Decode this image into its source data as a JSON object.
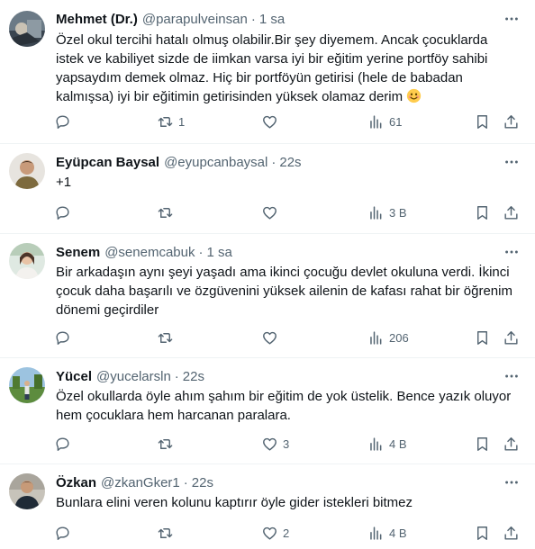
{
  "tweets": [
    {
      "name": "Mehmet (Dr.)",
      "handle": "@parapulveinsan",
      "time": "1 sa",
      "text": "Özel okul tercihi hatalı olmuş olabilir.Bir şey diyemem. Ancak çocuklarda istek ve kabiliyet sizde de iimkan varsa iyi bir eğitim yerine portföy sahibi yapsaydım demek olmaz. Hiç bir portföyün getirisi (hele de babadan kalmışsa) iyi bir eğitimin getirisinden yüksek olamaz derim",
      "emoji": "smiling-face-emoji",
      "replies": "",
      "retweets": "1",
      "likes": "",
      "views": "61"
    },
    {
      "name": "Eyüpcan Baysal",
      "handle": "@eyupcanbaysal",
      "time": "22s",
      "text": "+1",
      "replies": "",
      "retweets": "",
      "likes": "",
      "views": "3 B"
    },
    {
      "name": "Senem",
      "handle": "@senemcabuk",
      "time": "1 sa",
      "text": "Bir arkadaşın aynı şeyi yaşadı ama ikinci çocuğu devlet okuluna verdi. İkinci çocuk daha başarılı ve özgüvenini yüksek ailenin de kafası rahat bir öğrenim dönemi geçirdiler",
      "replies": "",
      "retweets": "",
      "likes": "",
      "views": "206"
    },
    {
      "name": "Yücel",
      "handle": "@yucelarsln",
      "time": "22s",
      "text": "Özel okullarda öyle ahım şahım bir eğitim de yok üstelik. Bence yazık oluyor hem çocuklara hem harcanan paralara.",
      "replies": "",
      "retweets": "",
      "likes": "3",
      "views": "4 B"
    },
    {
      "name": "Özkan",
      "handle": "@zkanGker1",
      "time": "22s",
      "text": "Bunlara elini veren kolunu kaptırır öyle gider istekleri bitmez",
      "replies": "",
      "retweets": "",
      "likes": "2",
      "views": "4 B"
    }
  ],
  "colors": {
    "text": "#0f1419",
    "secondary": "#536471",
    "divider": "#eff3f4"
  },
  "icons": [
    "more-icon",
    "reply-icon",
    "retweet-icon",
    "like-icon",
    "views-icon",
    "bookmark-icon",
    "share-icon"
  ]
}
